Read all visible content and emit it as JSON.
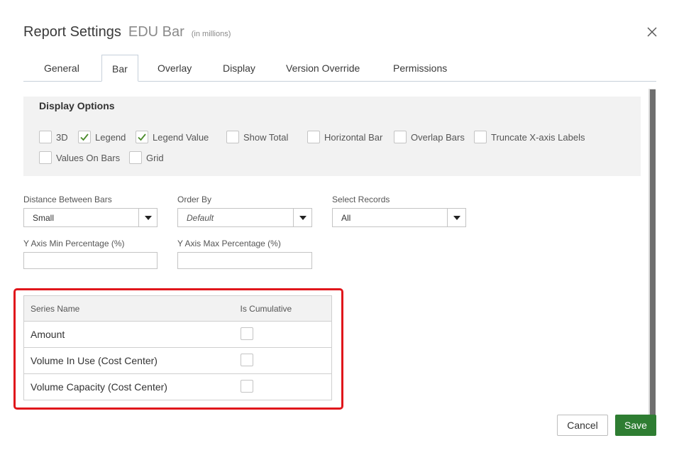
{
  "header": {
    "title": "Report Settings",
    "report_name": "EDU Bar",
    "unit_note": "(in millions)"
  },
  "icons": {
    "close": "close-icon",
    "checkmark": "check-icon",
    "dropdown": "caret-down-icon"
  },
  "tabs": [
    {
      "label": "General",
      "active": false
    },
    {
      "label": "Bar",
      "active": true
    },
    {
      "label": "Overlay",
      "active": false
    },
    {
      "label": "Display",
      "active": false
    },
    {
      "label": "Version Override",
      "active": false
    },
    {
      "label": "Permissions",
      "active": false
    }
  ],
  "display_options": {
    "title": "Display Options",
    "items": [
      {
        "label": "3D",
        "checked": false
      },
      {
        "label": "Legend",
        "checked": true
      },
      {
        "label": "Legend Value",
        "checked": true
      },
      {
        "label": "Show Total",
        "checked": false
      },
      {
        "label": "Horizontal Bar",
        "checked": false
      },
      {
        "label": "Overlap Bars",
        "checked": false
      },
      {
        "label": "Truncate X-axis Labels",
        "checked": false
      },
      {
        "label": "Values On Bars",
        "checked": false
      },
      {
        "label": "Grid",
        "checked": false
      }
    ]
  },
  "fields": {
    "distance_between_bars": {
      "label": "Distance Between Bars",
      "value": "Small"
    },
    "order_by": {
      "label": "Order By",
      "value": "Default"
    },
    "select_records": {
      "label": "Select Records",
      "value": "All"
    },
    "y_axis_min": {
      "label": "Y Axis Min Percentage (%)",
      "value": ""
    },
    "y_axis_max": {
      "label": "Y Axis Max Percentage (%)",
      "value": ""
    }
  },
  "series_table": {
    "headers": [
      "Series Name",
      "Is Cumulative"
    ],
    "rows": [
      {
        "name": "Amount",
        "is_cumulative": false
      },
      {
        "name": "Volume In Use (Cost Center)",
        "is_cumulative": false
      },
      {
        "name": "Volume Capacity (Cost Center)",
        "is_cumulative": false
      }
    ]
  },
  "buttons": {
    "cancel": "Cancel",
    "save": "Save"
  },
  "colors": {
    "save_button": "#2e7d32",
    "highlight_border": "#e0161b",
    "checkmark": "#4a8a2a"
  }
}
